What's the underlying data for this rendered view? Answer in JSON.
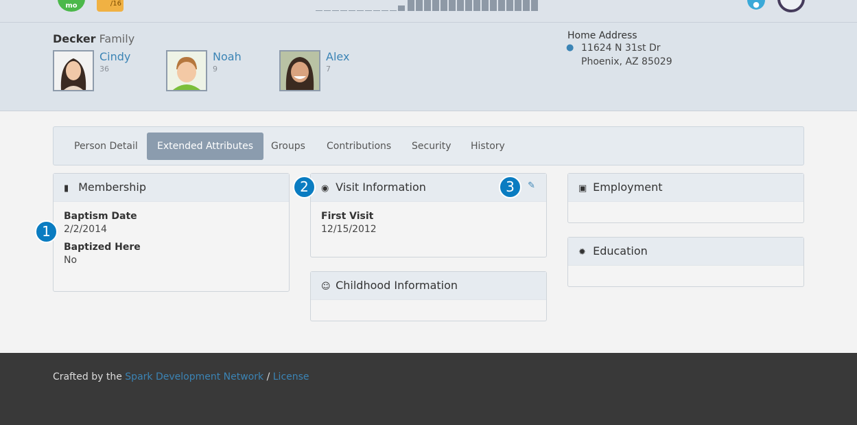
{
  "top": {
    "badge_green": "mo",
    "badge_orange": "/16"
  },
  "family": {
    "last_name": "Decker",
    "family_word": "Family",
    "members": [
      {
        "name": "Cindy",
        "age": "36"
      },
      {
        "name": "Noah",
        "age": "9"
      },
      {
        "name": "Alex",
        "age": "7"
      }
    ],
    "address_title": "Home Address",
    "address_line1": "11624 N 31st Dr",
    "address_line2": "Phoenix, AZ 85029"
  },
  "tabs": [
    {
      "label": "Person Detail",
      "active": false
    },
    {
      "label": "Extended Attributes",
      "active": true
    },
    {
      "label": "Groups",
      "active": false
    },
    {
      "label": "Contributions",
      "active": false
    },
    {
      "label": "Security",
      "active": false
    },
    {
      "label": "History",
      "active": false
    }
  ],
  "panels": {
    "membership": {
      "title": "Membership",
      "fields": [
        {
          "label": "Baptism Date",
          "value": "2/2/2014"
        },
        {
          "label": "Baptized Here",
          "value": "No"
        }
      ]
    },
    "visit": {
      "title": "Visit Information",
      "fields": [
        {
          "label": "First Visit",
          "value": "12/15/2012"
        }
      ]
    },
    "childhood": {
      "title": "Childhood Information"
    },
    "employment": {
      "title": "Employment"
    },
    "education": {
      "title": "Education"
    }
  },
  "callouts": [
    "1",
    "2",
    "3"
  ],
  "footer": {
    "prefix": "Crafted by the",
    "link1": "Spark Development Network",
    "separator": "/",
    "link2": "License"
  },
  "colors": {
    "link": "#3b84b5",
    "callout": "#0a7cc1",
    "active_tab": "#8b9cae",
    "footer_bg": "#393939"
  }
}
